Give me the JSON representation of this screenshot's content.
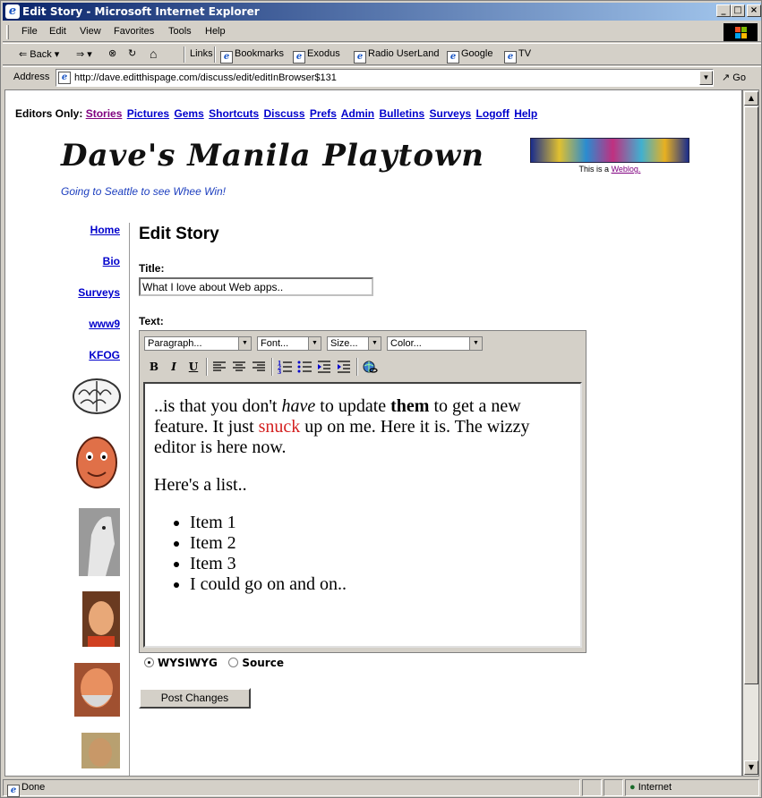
{
  "window": {
    "title": "Edit Story - Microsoft Internet Explorer"
  },
  "menu": [
    "File",
    "Edit",
    "View",
    "Favorites",
    "Tools",
    "Help"
  ],
  "toolbar": {
    "back": "Back",
    "links_label": "Links",
    "links": [
      "Bookmarks",
      "Exodus",
      "Radio UserLand",
      "Google",
      "TV"
    ]
  },
  "address": {
    "label": "Address",
    "url": "http://dave.editthispage.com/discuss/edit/editInBrowser$131",
    "go": "Go"
  },
  "page": {
    "editors_label": "Editors Only:",
    "editor_links": [
      "Stories",
      "Pictures",
      "Gems",
      "Shortcuts",
      "Discuss",
      "Prefs",
      "Admin",
      "Bulletins",
      "Surveys",
      "Logoff",
      "Help"
    ],
    "site_title": "Dave's Manila Playtown",
    "tagline": "Going to Seattle to see Whee Win!",
    "weblog_prefix": "This is a",
    "weblog_link": "Weblog.",
    "nav": [
      "Home",
      "Bio",
      "Surveys",
      "www9",
      "KFOG"
    ],
    "heading": "Edit Story",
    "title_label": "Title:",
    "title_value": "What I love about Web apps..",
    "text_label": "Text:",
    "editor": {
      "selects": [
        "Paragraph...",
        "Font...",
        "Size...",
        "Color..."
      ],
      "buttons": [
        "B",
        "I",
        "U"
      ],
      "p1_a": "..is that you don't",
      "p1_em": "have",
      "p1_b": "to update",
      "p1_strong": "them",
      "p1_c": "to get a new feature. It just",
      "p1_red": "snuck",
      "p1_d": "up on me. Here it is. The wizzy editor is here now.",
      "p2": "Here's a list..",
      "items": [
        "Item 1",
        "Item 2",
        "Item 3",
        "I could go on and on.."
      ]
    },
    "mode_wysiwyg": "WYSIWYG",
    "mode_source": "Source",
    "post_button": "Post Changes"
  },
  "status": {
    "text": "Done",
    "zone": "Internet"
  },
  "colors": {
    "link": "#0000cc",
    "visited": "#800080",
    "titlebar": "#0a246a",
    "red_text": "#d42020"
  }
}
